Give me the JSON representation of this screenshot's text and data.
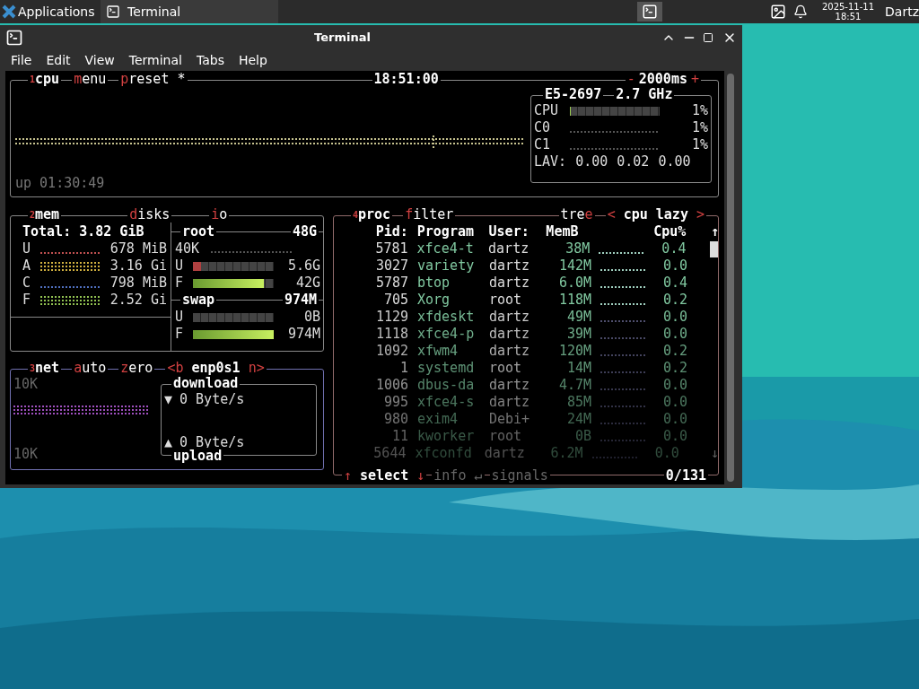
{
  "taskbar": {
    "apps_menu": "Applications",
    "task": "Terminal",
    "date": "2025-11-11",
    "time": "18:51",
    "user": "Dartz"
  },
  "window": {
    "title": "Terminal",
    "menu": [
      "File",
      "Edit",
      "View",
      "Terminal",
      "Tabs",
      "Help"
    ]
  },
  "cpu": {
    "number": "1",
    "title": "cpu",
    "tabs": [
      {
        "hotkey": "m",
        "rest": "enu"
      },
      {
        "hotkey": "p",
        "rest": "reset *"
      }
    ],
    "clock": "18:51:00",
    "minus": "-",
    "interval": "2000ms",
    "plus": "+",
    "uptime": "up 01:30:49",
    "model": "E5-2697",
    "freq": "2.7 GHz",
    "rows": [
      {
        "label": "CPU",
        "kind": "bar",
        "level": 0.01,
        "value": "1%"
      },
      {
        "label": "C0",
        "kind": "graph",
        "value": "1%"
      },
      {
        "label": "C1",
        "kind": "graph",
        "value": "1%"
      }
    ],
    "lav_label": "LAV:",
    "lav": [
      "0.00",
      "0.02",
      "0.00"
    ]
  },
  "mem": {
    "number": "2",
    "title": "mem",
    "total_label": "Total:",
    "total": "3.82 GiB",
    "rows": [
      {
        "label": "U",
        "value": "678 MiB",
        "color": "#c05050"
      },
      {
        "label": "A",
        "value": "3.16 Gi",
        "color": "#d0b040"
      },
      {
        "label": "C",
        "value": "798 MiB",
        "color": "#5070c0"
      },
      {
        "label": "F",
        "value": "2.52 Gi",
        "color": "#90c050"
      }
    ]
  },
  "disks": {
    "tabs": [
      {
        "hotkey": "d",
        "rest": "isks"
      },
      {
        "hotkey": "i",
        "rest": "o"
      }
    ],
    "volumes": [
      {
        "name": "root",
        "size": "48G",
        "io": "40K",
        "rows": [
          {
            "label": "U",
            "level": 0.1,
            "value": "5.6G"
          },
          {
            "label": "F",
            "level": 0.88,
            "value": "42G"
          }
        ]
      },
      {
        "name": "swap",
        "size": "974M",
        "rows": [
          {
            "label": "U",
            "level": 0,
            "value": "0B"
          },
          {
            "label": "F",
            "level": 1,
            "value": "974M"
          }
        ]
      }
    ]
  },
  "net": {
    "number": "3",
    "title": "net",
    "tabs": [
      {
        "hotkey": "a",
        "rest": "uto"
      },
      {
        "hotkey": "z",
        "rest": "ero"
      }
    ],
    "prev": "<b",
    "iface": "enp0s1",
    "next": "n>",
    "scale_top": "10K",
    "scale_bottom": "10K",
    "download_title": "download",
    "download_arrow": "▼",
    "download": "0 Byte/s",
    "upload_arrow": "▲",
    "upload": "0 Byte/s",
    "upload_title": "upload"
  },
  "proc": {
    "number": "4",
    "title": "proc",
    "filter": {
      "hotkey": "f",
      "rest": "ilter"
    },
    "tree": {
      "rest": "tre",
      "hotkey": "e"
    },
    "prev": "<",
    "sort": "cpu lazy",
    "next": ">",
    "columns": [
      "Pid:",
      "Program",
      "User:",
      "MemB",
      "Cpu%"
    ],
    "scroll_up": "↑",
    "scroll_down": "↓",
    "rows": [
      [
        "5781",
        "xfce4-t",
        "dartz",
        "38M",
        "0.4"
      ],
      [
        "3027",
        "variety",
        "dartz",
        "142M",
        "0.0"
      ],
      [
        "5787",
        "btop",
        "dartz",
        "6.0M",
        "0.4"
      ],
      [
        "705",
        "Xorg",
        "root",
        "118M",
        "0.2"
      ],
      [
        "1129",
        "xfdeskt",
        "dartz",
        "49M",
        "0.0"
      ],
      [
        "1118",
        "xfce4-p",
        "dartz",
        "39M",
        "0.0"
      ],
      [
        "1092",
        "xfwm4",
        "dartz",
        "120M",
        "0.2"
      ],
      [
        "1",
        "systemd",
        "root",
        "14M",
        "0.2"
      ],
      [
        "1006",
        "dbus-da",
        "dartz",
        "4.7M",
        "0.0"
      ],
      [
        "995",
        "xfce4-s",
        "dartz",
        "85M",
        "0.0"
      ],
      [
        "980",
        "exim4",
        "Debi+",
        "24M",
        "0.0"
      ],
      [
        "11",
        "kworker",
        "root",
        "0B",
        "0.0"
      ],
      [
        "5644",
        "xfconfd",
        "dartz",
        "6.2M",
        "0.0"
      ]
    ],
    "footer": {
      "up": "↑",
      "select": "select",
      "down": "↓",
      "info": "info",
      "enter": "↵",
      "signals": "signals",
      "count": "0/131"
    }
  }
}
